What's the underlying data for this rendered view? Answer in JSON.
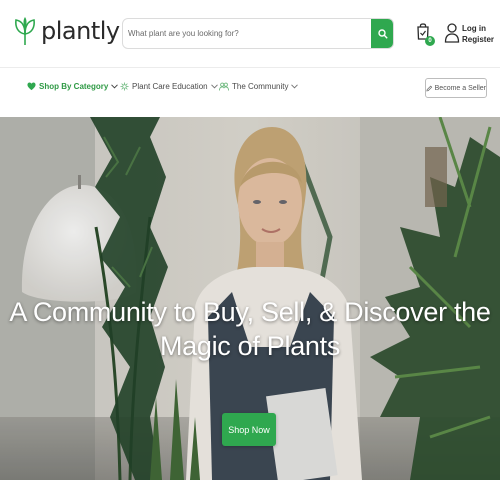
{
  "brand": {
    "name": "plantly",
    "accent": "#2fa84f"
  },
  "search": {
    "placeholder": "What plant are you looking for?"
  },
  "auth": {
    "login": "Log in",
    "register": "Register"
  },
  "cart": {
    "count": "0"
  },
  "nav": {
    "items": [
      {
        "label": "Shop By Category",
        "icon": "heart-icon",
        "active": true
      },
      {
        "label": "Plant Care Education",
        "icon": "sprout-icon",
        "active": false
      },
      {
        "label": "The Community",
        "icon": "people-icon",
        "active": false
      }
    ],
    "sell_label": "Become a Seller"
  },
  "hero": {
    "headline_line1": "A Community to Buy, Sell, & Discover the",
    "headline_line2": "Magic of Plants",
    "cta_label": "Shop Now"
  }
}
